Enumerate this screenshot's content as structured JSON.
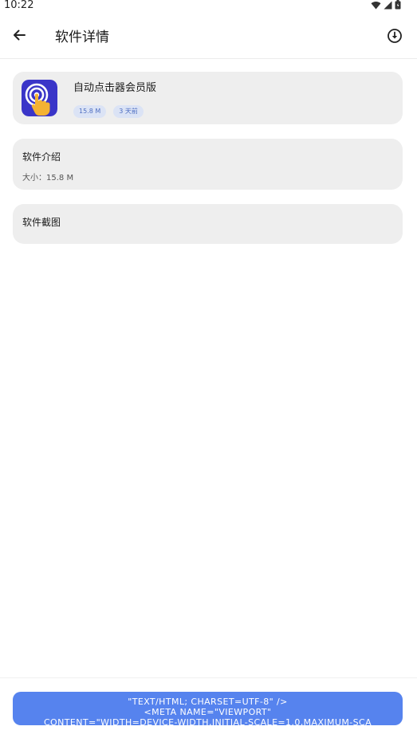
{
  "status_bar": {
    "time": "10:22",
    "icons": [
      "wifi-icon",
      "signal-icon",
      "battery-icon"
    ]
  },
  "app_bar": {
    "title": "软件详情",
    "back_icon": "arrow-left-icon",
    "action_icon": "download-circle-icon"
  },
  "app_card": {
    "name": "自动点击器会员版",
    "icon": "tap-finger-app-icon",
    "tags": [
      "15.8 M",
      "3 天前"
    ]
  },
  "intro_card": {
    "title": "软件介绍",
    "size_text": "大小：15.8 M"
  },
  "screenshots_card": {
    "title": "软件截图"
  },
  "primary_button": {
    "lines": [
      "\"TEXT/HTML; CHARSET=UTF-8\" />",
      "<META NAME=\"VIEWPORT\"",
      "CONTENT=\"WIDTH=DEVICE-WIDTH,INITIAL-SCALE=1.0,MAXIMUM-SCA"
    ]
  },
  "colors": {
    "accent": "#5683ee",
    "card_bg": "#eeeeee",
    "tag_bg": "#dbe3f5",
    "tag_text": "#4f6fc2",
    "icon_bg": "#3a35c8",
    "icon_hand": "#f4b233"
  }
}
